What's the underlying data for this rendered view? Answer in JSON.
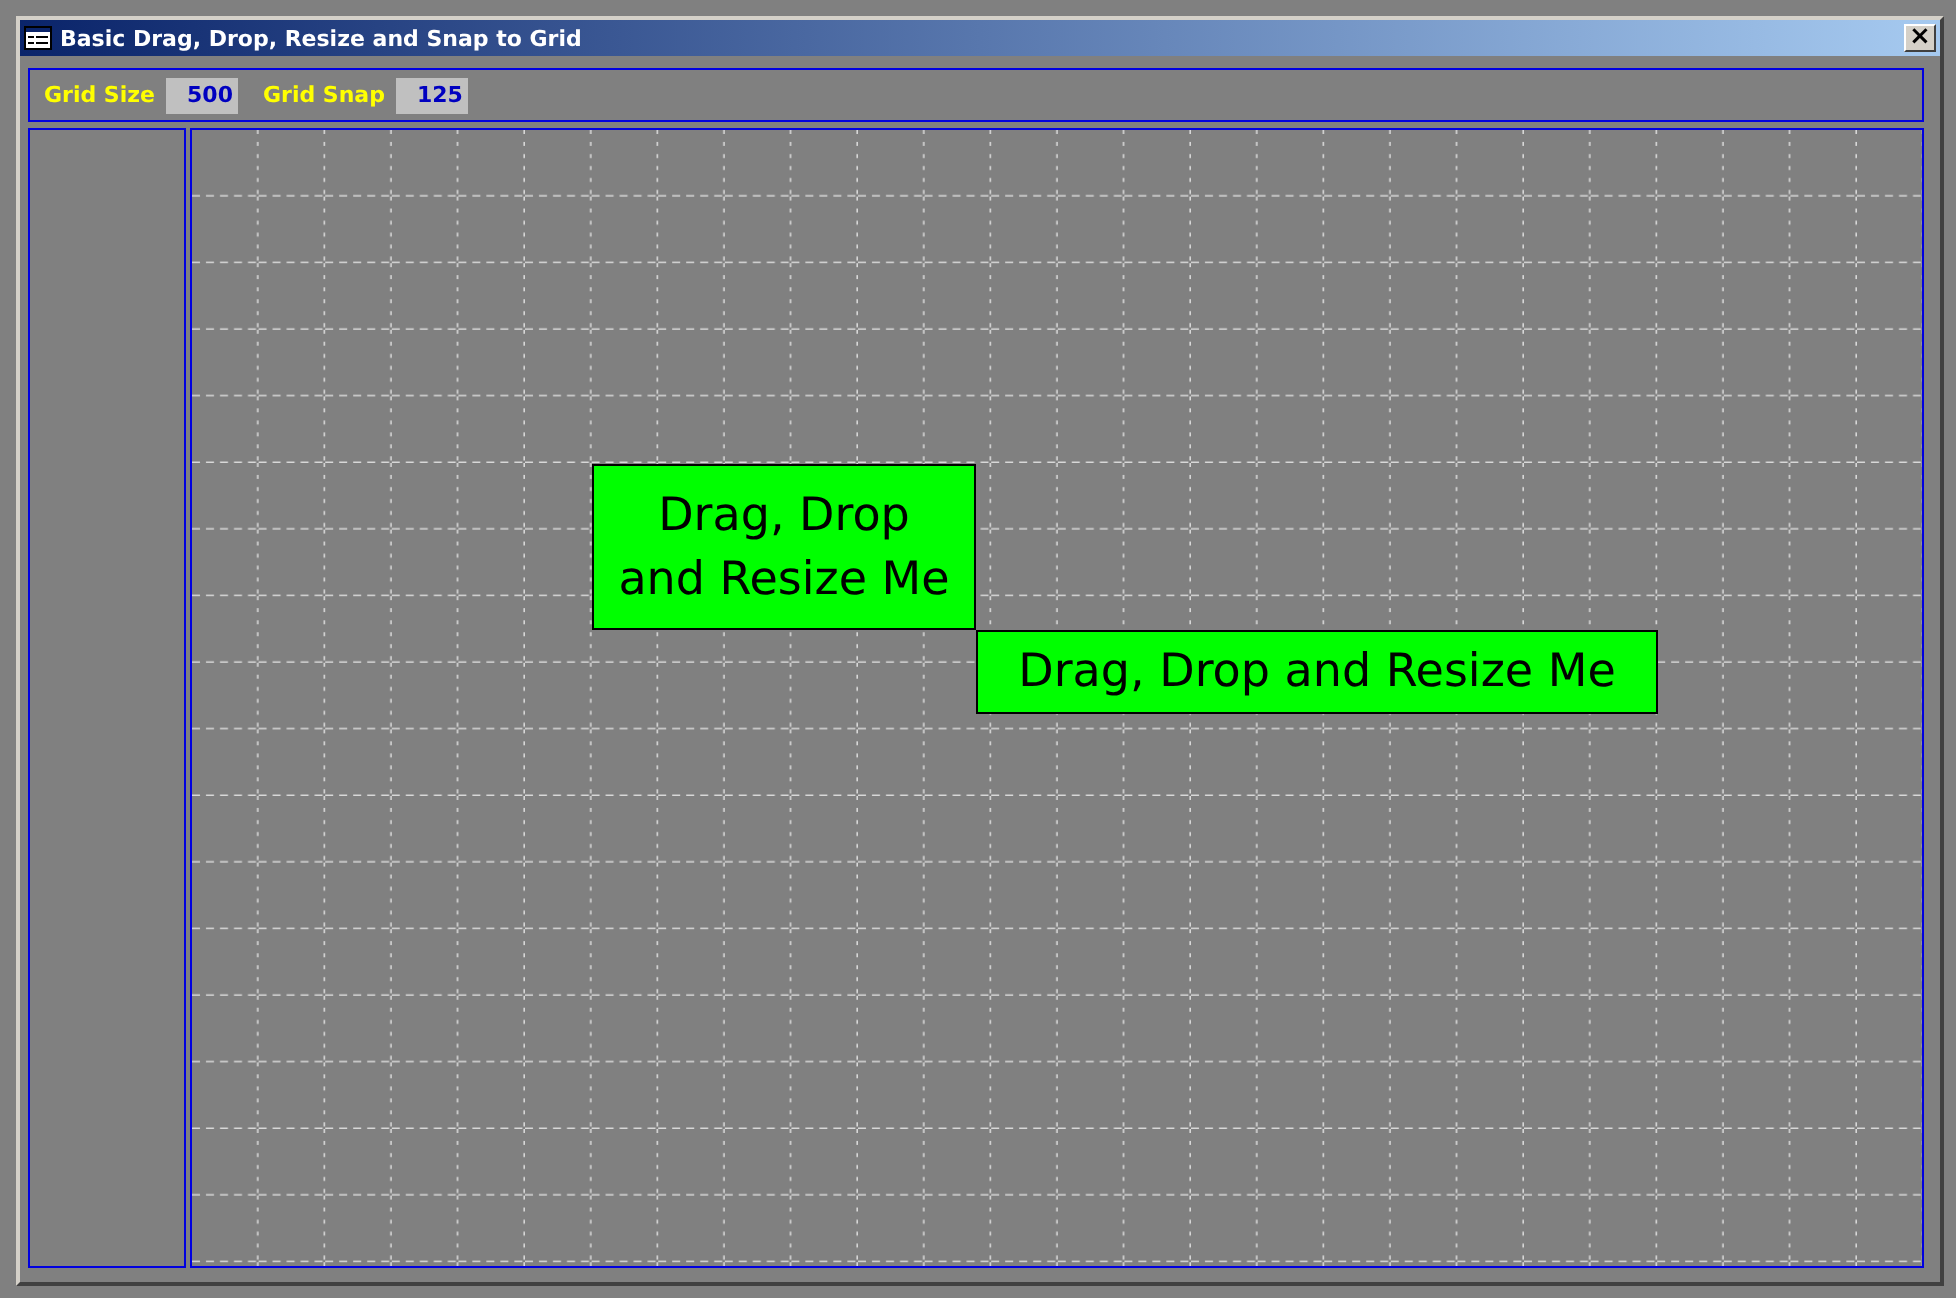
{
  "window": {
    "title": "Basic Drag, Drop, Resize and Snap to Grid",
    "close": "×"
  },
  "toolbar": {
    "fields": [
      {
        "label": "Grid Size",
        "value": "500"
      },
      {
        "label": "Grid Snap",
        "value": "125"
      }
    ]
  },
  "canvas": {
    "boxes": [
      {
        "kind": "wrap",
        "text": "Drag, Drop and Resize Me"
      },
      {
        "kind": "wide",
        "text": "Drag, Drop and Resize Me"
      }
    ]
  }
}
